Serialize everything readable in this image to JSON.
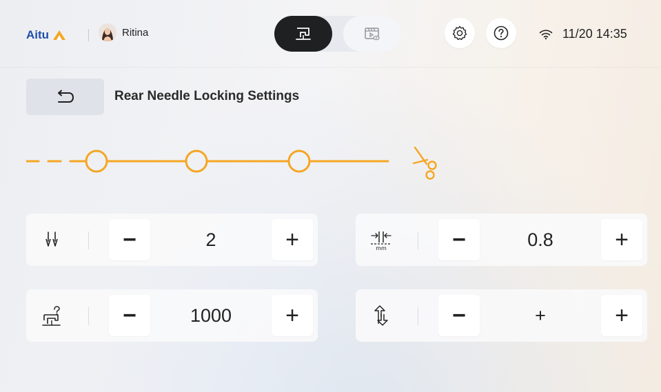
{
  "header": {
    "brand": "Aitu",
    "user_name": "Ritina",
    "datetime": "11/20 14:35"
  },
  "page": {
    "title": "Rear Needle Locking Settings"
  },
  "settings": [
    {
      "icon": "needle-count-icon",
      "value": "2"
    },
    {
      "icon": "stitch-length-mm-icon",
      "value": "0.8"
    },
    {
      "icon": "machine-question-icon",
      "value": "1000"
    },
    {
      "icon": "direction-arrows-icon",
      "value": "+"
    }
  ],
  "controls": {
    "minus_symbol": "−",
    "plus_symbol": "+"
  },
  "icons": {
    "brand_logo": "aitu-logo",
    "back": "back-arrow-icon",
    "mode_active": "sewing-machine-icon",
    "mode_inactive": "video-playback-icon",
    "settings": "gear-icon",
    "help": "question-icon",
    "wifi": "wifi-icon",
    "cut": "scissors-icon"
  },
  "colors": {
    "accent": "#F5A623",
    "brand_blue": "#1F4FA8",
    "active_dark": "#1F2022"
  }
}
